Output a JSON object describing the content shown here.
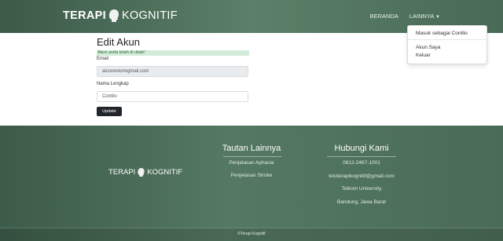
{
  "header": {
    "brand_left": "TERAPI",
    "brand_right": "KOGNITIF",
    "nav": [
      {
        "label": "BERANDA"
      },
      {
        "label": "LAINNYA"
      }
    ],
    "dropdown": {
      "login_label": "Masuk sebagai Contlio",
      "account_label": "Akun Saya",
      "logout_label": "Keluar"
    }
  },
  "main": {
    "title": "Edit Akun",
    "alert": "Akun anda telah di ubah!",
    "email_label": "Email",
    "email_value": "aiconestorivgmail.com",
    "name_label": "Nama Lengkap",
    "name_value": "Contlio",
    "update_label": "Update"
  },
  "footer": {
    "brand_left": "TERAPI",
    "brand_right": "KOGNITIF",
    "links_title": "Tautan Lainnya",
    "links": [
      "Penjelasan Aphasia",
      "Penjelasan Stroke"
    ],
    "contact_title": "Hubungi Kami",
    "contact": [
      "0812-2467-1001",
      "teluterapikognitif@gmail.com",
      "Telkom University",
      "Bandung, Jawa Barat"
    ],
    "copyright": "©Terapi Kognitif"
  },
  "colors": {
    "header_green": "#4a6c57",
    "alert_bg": "#d3ecd9",
    "button_dark": "#212529"
  }
}
